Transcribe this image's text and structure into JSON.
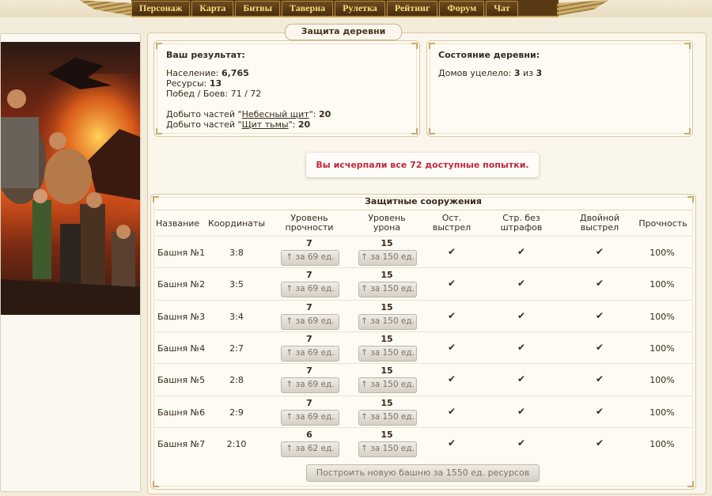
{
  "nav": {
    "items": [
      "Персонаж",
      "Карта",
      "Битвы",
      "Таверна",
      "Рулетка",
      "Рейтинг",
      "Форум",
      "Чат"
    ]
  },
  "page_title": "Защита деревни",
  "result": {
    "title": "Ваш результат:",
    "population_label": "Население:",
    "population": "6,765",
    "resources_label": "Ресурсы:",
    "resources": "13",
    "wins_label": "Побед / Боев:",
    "wins": "71 / 72",
    "parts1_prefix": "Добыто частей \"",
    "parts1_item": "Небесный щит",
    "parts1_suffix": "\":",
    "parts1_count": "20",
    "parts2_prefix": "Добыто частей \"",
    "parts2_item": "Щит тьмы",
    "parts2_suffix": "\":",
    "parts2_count": "20"
  },
  "village": {
    "title": "Состояние деревни:",
    "houses_label": "Домов уцелело:",
    "houses_left": "3",
    "houses_of": "из",
    "houses_total": "3"
  },
  "notice": "Вы исчерпали все 72 доступные попытки.",
  "defense": {
    "title": "Защитные сооружения",
    "headers": {
      "name": "Название",
      "coords": "Координаты",
      "strength_1": "Уровень",
      "strength_2": "прочности",
      "damage_1": "Уровень",
      "damage_2": "урона",
      "stop_1": "Ост.",
      "stop_2": "выстрел",
      "nopen_1": "Стр. без",
      "nopen_2": "штрафов",
      "double_1": "Двойной",
      "double_2": "выстрел",
      "durability": "Прочность"
    },
    "check": "✔",
    "rows": [
      {
        "name": "Башня №1",
        "coords": "3:8",
        "strength": "7",
        "strength_up": "↑ за 69 ед.",
        "damage": "15",
        "damage_up": "↑ за 150 ед.",
        "durability": "100%"
      },
      {
        "name": "Башня №2",
        "coords": "3:5",
        "strength": "7",
        "strength_up": "↑ за 69 ед.",
        "damage": "15",
        "damage_up": "↑ за 150 ед.",
        "durability": "100%"
      },
      {
        "name": "Башня №3",
        "coords": "3:4",
        "strength": "7",
        "strength_up": "↑ за 69 ед.",
        "damage": "15",
        "damage_up": "↑ за 150 ед.",
        "durability": "100%"
      },
      {
        "name": "Башня №4",
        "coords": "2:7",
        "strength": "7",
        "strength_up": "↑ за 69 ед.",
        "damage": "15",
        "damage_up": "↑ за 150 ед.",
        "durability": "100%"
      },
      {
        "name": "Башня №5",
        "coords": "2:8",
        "strength": "7",
        "strength_up": "↑ за 69 ед.",
        "damage": "15",
        "damage_up": "↑ за 150 ед.",
        "durability": "100%"
      },
      {
        "name": "Башня №6",
        "coords": "2:9",
        "strength": "7",
        "strength_up": "↑ за 69 ед.",
        "damage": "15",
        "damage_up": "↑ за 150 ед.",
        "durability": "100%"
      },
      {
        "name": "Башня №7",
        "coords": "2:10",
        "strength": "6",
        "strength_up": "↑ за 62 ед.",
        "damage": "15",
        "damage_up": "↑ за 150 ед.",
        "durability": "100%"
      }
    ],
    "build_button": "Построить новую башню за 1550 ед. ресурсов"
  },
  "colors": {
    "nav_text": "#f6dc7a",
    "nav_bg": "#5a3a15",
    "notice_text": "#c3283a",
    "page_bg": "#f4ecdb"
  },
  "icons": {
    "artwork": "heroes-battle-artwork",
    "check": "check-icon"
  }
}
